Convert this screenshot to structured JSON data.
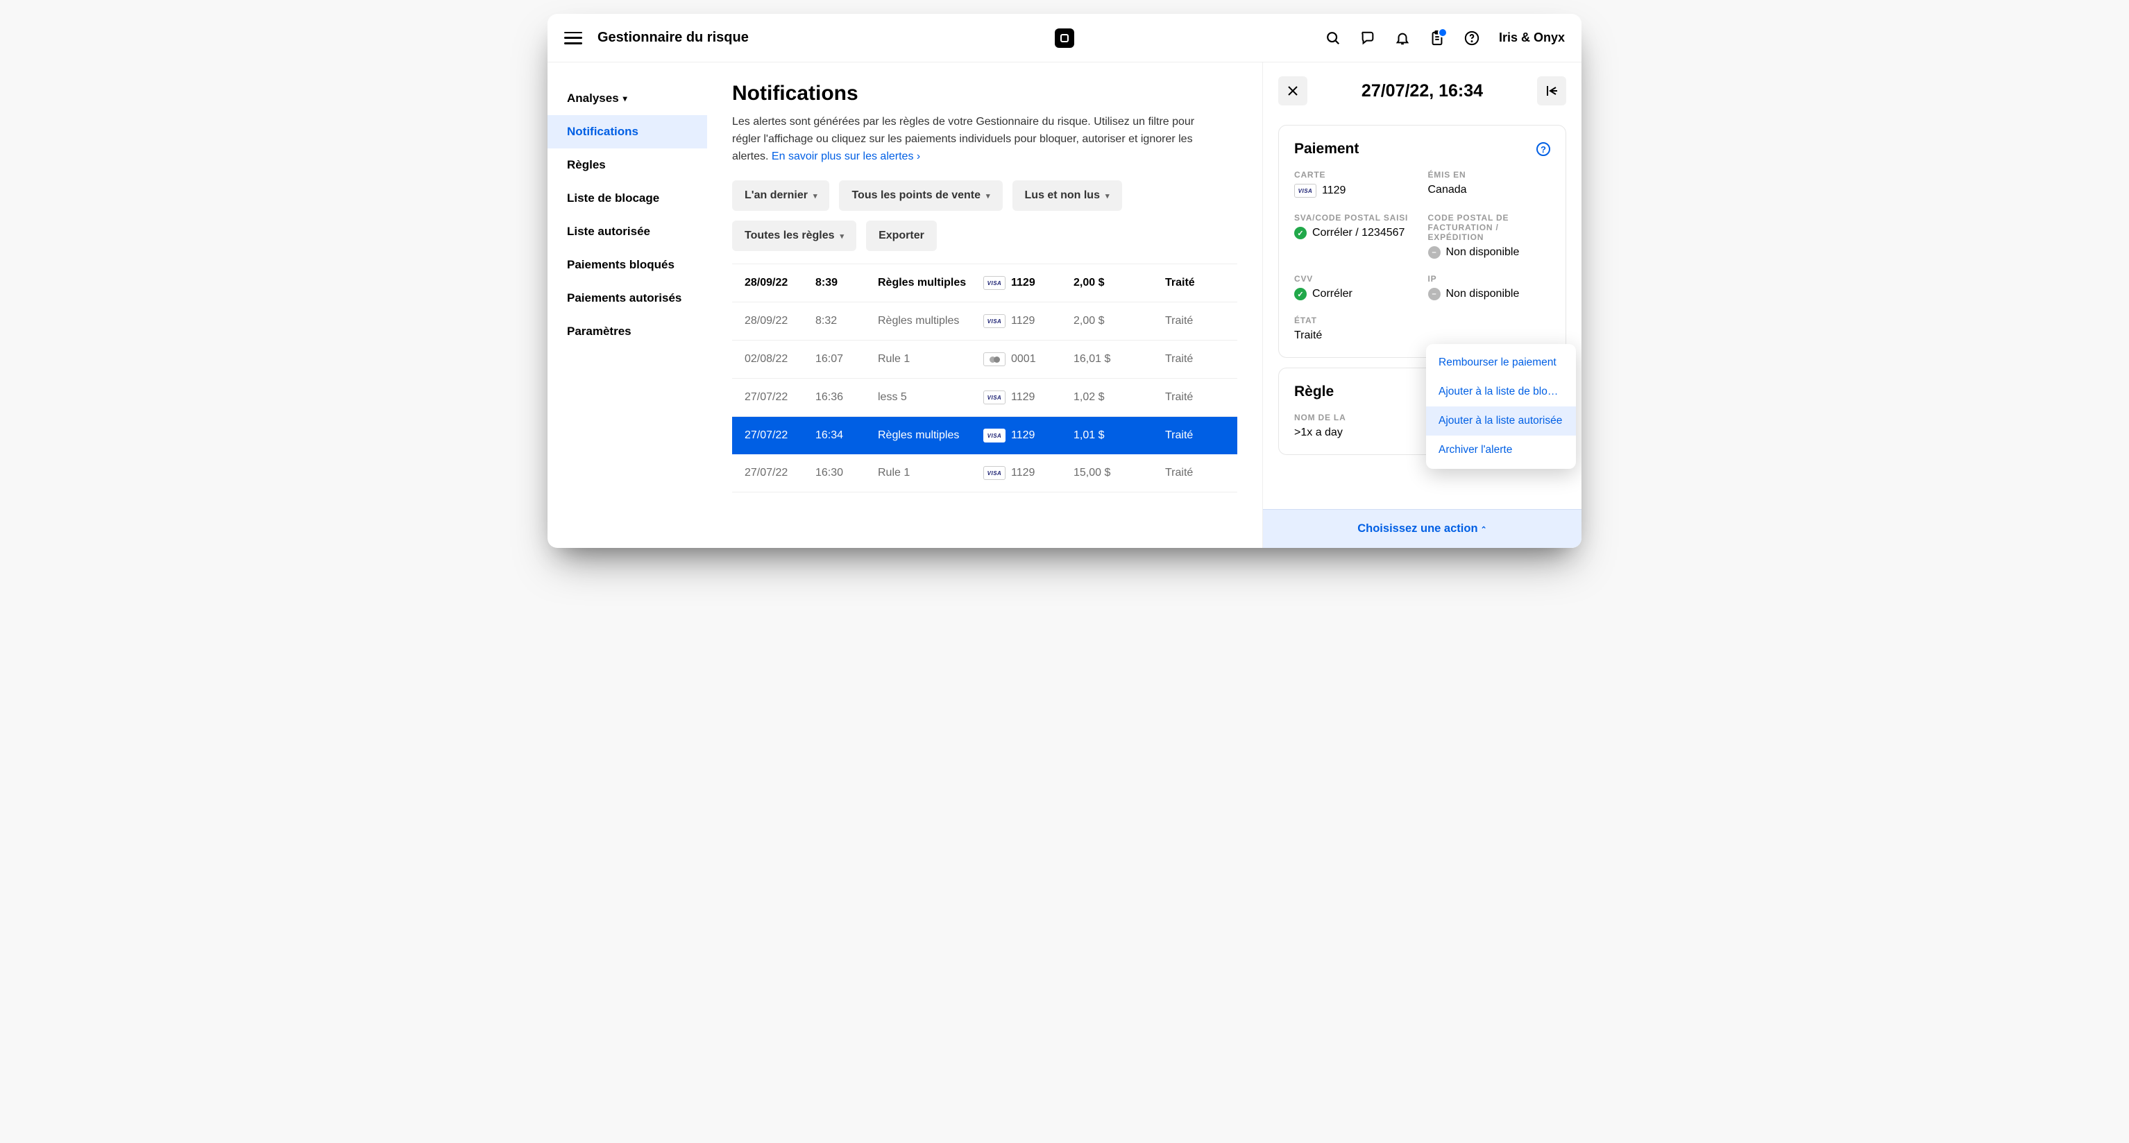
{
  "header": {
    "app_title": "Gestionnaire du risque",
    "merchant": "Iris & Onyx"
  },
  "sidebar": {
    "items": [
      {
        "label": "Analyses",
        "has_chevron": true
      },
      {
        "label": "Notifications"
      },
      {
        "label": "Règles"
      },
      {
        "label": "Liste de blocage"
      },
      {
        "label": "Liste autorisée"
      },
      {
        "label": "Paiements bloqués"
      },
      {
        "label": "Paiements autorisés"
      },
      {
        "label": "Paramètres"
      }
    ]
  },
  "main": {
    "title": "Notifications",
    "desc_a": "Les alertes sont générées par les règles de votre Gestionnaire du risque. Utilisez un filtre pour régler l'affichage ou cliquez sur les paiements individuels pour bloquer, autoriser et ignorer les alertes. ",
    "desc_link": "En savoir plus sur les alertes ›",
    "filters": {
      "f0": "L'an dernier",
      "f1": "Tous les points de vente",
      "f2": "Lus et non lus",
      "f3": "Toutes les règles",
      "export": "Exporter"
    },
    "rows": [
      {
        "date": "28/09/22",
        "time": "8:39",
        "rule": "Règles multiples",
        "brand": "visa",
        "last4": "1129",
        "amount": "2,00 $",
        "status": "Traité",
        "header": true
      },
      {
        "date": "28/09/22",
        "time": "8:32",
        "rule": "Règles multiples",
        "brand": "visa",
        "last4": "1129",
        "amount": "2,00 $",
        "status": "Traité"
      },
      {
        "date": "02/08/22",
        "time": "16:07",
        "rule": "Rule 1",
        "brand": "mc",
        "last4": "0001",
        "amount": "16,01 $",
        "status": "Traité"
      },
      {
        "date": "27/07/22",
        "time": "16:36",
        "rule": "less 5",
        "brand": "visa",
        "last4": "1129",
        "amount": "1,02 $",
        "status": "Traité"
      },
      {
        "date": "27/07/22",
        "time": "16:34",
        "rule": "Règles multiples",
        "brand": "visa",
        "last4": "1129",
        "amount": "1,01 $",
        "status": "Traité",
        "selected": true
      },
      {
        "date": "27/07/22",
        "time": "16:30",
        "rule": "Rule 1",
        "brand": "visa",
        "last4": "1129",
        "amount": "15,00 $",
        "status": "Traité"
      }
    ]
  },
  "panel": {
    "title": "27/07/22, 16:34",
    "payment": {
      "title": "Paiement",
      "labels": {
        "card": "CARTE",
        "issued": "ÉMIS EN",
        "avs": "SVA/CODE POSTAL SAISI",
        "billzip": "CODE POSTAL DE FACTURATION / EXPÉDITION",
        "cvv": "CVV",
        "ip": "IP",
        "state": "ÉTAT"
      },
      "card_brand": "visa",
      "card_last4": "1129",
      "issued_in": "Canada",
      "avs_value": "Corréler / 1234567",
      "billzip_value": "Non disponible",
      "cvv_value": "Corréler",
      "ip_value": "Non disponible",
      "state_value": "Traité"
    },
    "rule": {
      "title": "Règle",
      "name_label": "NOM DE LA",
      "name_value": ">1x a day"
    },
    "actions": {
      "a0": "Rembourser le paiement",
      "a1": "Ajouter à la liste de bloc…",
      "a2": "Ajouter à la liste autorisée",
      "a3": "Archiver l'alerte"
    },
    "choose": "Choisissez une action"
  }
}
